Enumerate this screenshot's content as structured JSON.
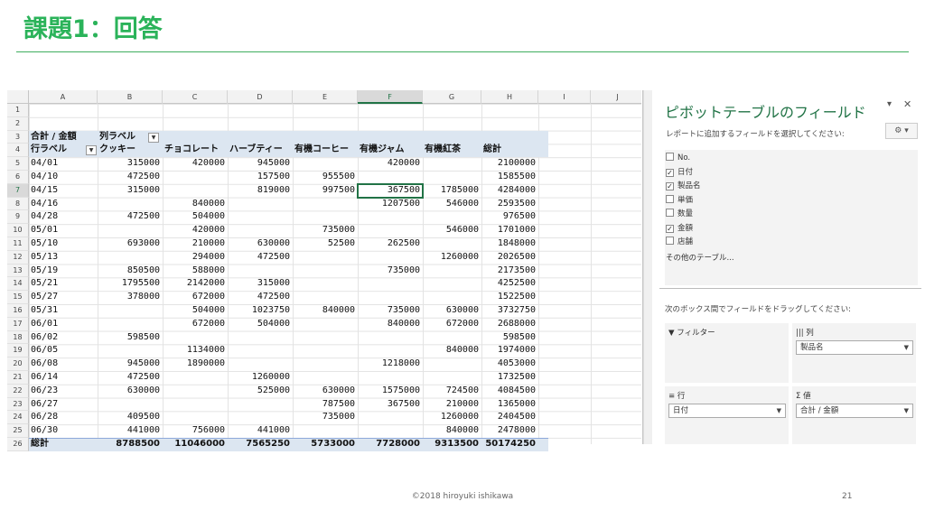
{
  "slide": {
    "title": "課題1：回答",
    "footer": "©2018 hiroyuki ishikawa",
    "page_number": "21"
  },
  "sheet": {
    "columns": [
      "A",
      "B",
      "C",
      "D",
      "E",
      "F",
      "G",
      "H",
      "I",
      "J"
    ],
    "row_numbers": [
      "1",
      "2",
      "3",
      "4",
      "5",
      "6",
      "7",
      "8",
      "9",
      "10",
      "11",
      "12",
      "13",
      "14",
      "15",
      "16",
      "17",
      "18",
      "19",
      "20",
      "21",
      "22",
      "23",
      "24",
      "25",
      "26"
    ],
    "active_column": "F",
    "active_row": "7",
    "pivot": {
      "value_label": "合計 / 金額",
      "column_labels": "列ラベル",
      "row_labels": "行ラベル",
      "headers": [
        "クッキー",
        "チョコレート",
        "ハーブティー",
        "有機コーヒー",
        "有機ジャム",
        "有機紅茶",
        "総計"
      ],
      "rows": [
        {
          "date": "04/01",
          "v": [
            "315000",
            "420000",
            "945000",
            "",
            "420000",
            "",
            "2100000"
          ]
        },
        {
          "date": "04/10",
          "v": [
            "472500",
            "",
            "157500",
            "955500",
            "",
            "",
            "1585500"
          ]
        },
        {
          "date": "04/15",
          "v": [
            "315000",
            "",
            "819000",
            "997500",
            "367500",
            "1785000",
            "4284000"
          ]
        },
        {
          "date": "04/16",
          "v": [
            "",
            "840000",
            "",
            "",
            "1207500",
            "546000",
            "2593500"
          ]
        },
        {
          "date": "04/28",
          "v": [
            "472500",
            "504000",
            "",
            "",
            "",
            "",
            "976500"
          ]
        },
        {
          "date": "05/01",
          "v": [
            "",
            "420000",
            "",
            "735000",
            "",
            "546000",
            "1701000"
          ]
        },
        {
          "date": "05/10",
          "v": [
            "693000",
            "210000",
            "630000",
            "52500",
            "262500",
            "",
            "1848000"
          ]
        },
        {
          "date": "05/13",
          "v": [
            "",
            "294000",
            "472500",
            "",
            "",
            "1260000",
            "2026500"
          ]
        },
        {
          "date": "05/19",
          "v": [
            "850500",
            "588000",
            "",
            "",
            "735000",
            "",
            "2173500"
          ]
        },
        {
          "date": "05/21",
          "v": [
            "1795500",
            "2142000",
            "315000",
            "",
            "",
            "",
            "4252500"
          ]
        },
        {
          "date": "05/27",
          "v": [
            "378000",
            "672000",
            "472500",
            "",
            "",
            "",
            "1522500"
          ]
        },
        {
          "date": "05/31",
          "v": [
            "",
            "504000",
            "1023750",
            "840000",
            "735000",
            "630000",
            "3732750"
          ]
        },
        {
          "date": "06/01",
          "v": [
            "",
            "672000",
            "504000",
            "",
            "840000",
            "672000",
            "2688000"
          ]
        },
        {
          "date": "06/02",
          "v": [
            "598500",
            "",
            "",
            "",
            "",
            "",
            "598500"
          ]
        },
        {
          "date": "06/05",
          "v": [
            "",
            "1134000",
            "",
            "",
            "",
            "840000",
            "1974000"
          ]
        },
        {
          "date": "06/08",
          "v": [
            "945000",
            "1890000",
            "",
            "",
            "1218000",
            "",
            "4053000"
          ]
        },
        {
          "date": "06/14",
          "v": [
            "472500",
            "",
            "1260000",
            "",
            "",
            "",
            "1732500"
          ]
        },
        {
          "date": "06/23",
          "v": [
            "630000",
            "",
            "525000",
            "630000",
            "1575000",
            "724500",
            "4084500"
          ]
        },
        {
          "date": "06/27",
          "v": [
            "",
            "",
            "",
            "787500",
            "367500",
            "210000",
            "1365000"
          ]
        },
        {
          "date": "06/28",
          "v": [
            "409500",
            "",
            "",
            "735000",
            "",
            "1260000",
            "2404500"
          ]
        },
        {
          "date": "06/30",
          "v": [
            "441000",
            "756000",
            "441000",
            "",
            "",
            "840000",
            "2478000"
          ]
        }
      ],
      "total_label": "総計",
      "totals": [
        "8788500",
        "11046000",
        "7565250",
        "5733000",
        "7728000",
        "9313500",
        "50174250"
      ]
    }
  },
  "pane": {
    "title": "ピボットテーブルのフィールド",
    "subtitle": "レポートに追加するフィールドを選択してください:",
    "fields": [
      {
        "label": "No.",
        "checked": false
      },
      {
        "label": "日付",
        "checked": true
      },
      {
        "label": "製品名",
        "checked": true
      },
      {
        "label": "単価",
        "checked": false
      },
      {
        "label": "数量",
        "checked": false
      },
      {
        "label": "金額",
        "checked": true
      },
      {
        "label": "店舗",
        "checked": false
      }
    ],
    "other_tables": "その他のテーブル...",
    "drag_hint": "次のボックス間でフィールドをドラッグしてください:",
    "filters_label": "フィルター",
    "columns_label": "列",
    "rows_label": "行",
    "values_label": "値",
    "columns_field": "製品名",
    "rows_field": "日付",
    "values_field": "合計 / 金額"
  },
  "colors": {
    "title_green": "#2bb35a",
    "pivot_header_bg": "#dce6f1",
    "excel_green": "#217346"
  },
  "icons": [
    "filter-icon",
    "columns-icon",
    "rows-icon",
    "sigma-icon",
    "gear-icon",
    "close-icon",
    "dropdown-arrow-icon"
  ]
}
